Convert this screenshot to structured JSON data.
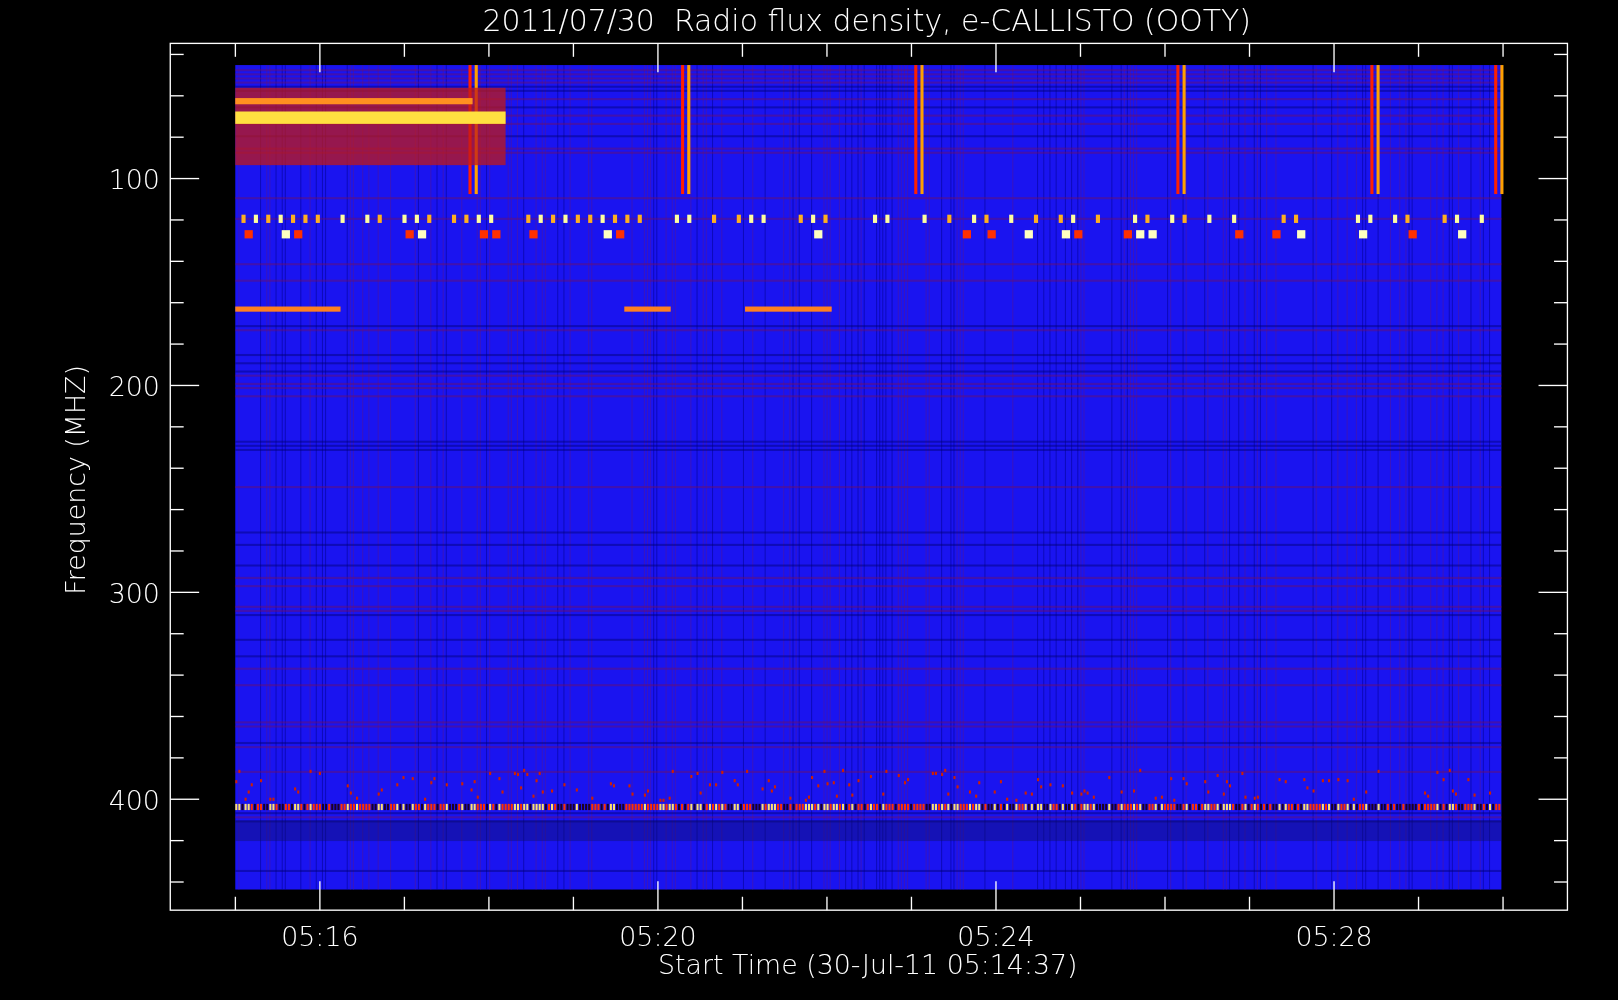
{
  "title": "2011/07/30  Radio flux density, e-CALLISTO (OOTY)",
  "y_axis": {
    "label": "Frequency (MHZ)",
    "ticks": [
      "100",
      "200",
      "300",
      "400"
    ]
  },
  "x_axis": {
    "label": "Start Time (30-Jul-11 05:14:37)",
    "ticks": [
      "05:16",
      "05:20",
      "05:24",
      "05:28"
    ]
  }
}
